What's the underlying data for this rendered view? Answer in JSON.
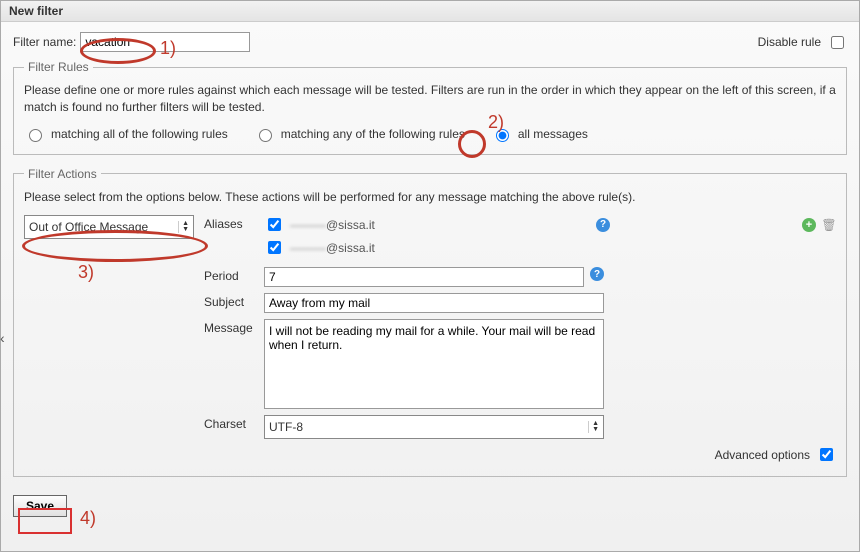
{
  "window": {
    "title": "New filter"
  },
  "filterName": {
    "label": "Filter name:",
    "value": "vacation"
  },
  "disable": {
    "label": "Disable rule"
  },
  "rules": {
    "legend": "Filter Rules",
    "help": "Please define one or more rules against which each message will be tested. Filters are run in the order in which they appear on the left of this screen, if a match is found no further filters will be tested.",
    "opts": {
      "all": "matching all of the following rules",
      "any": "matching any of the following rules",
      "allmsg": "all messages"
    }
  },
  "actions": {
    "legend": "Filter Actions",
    "help": "Please select from the options below. These actions will be performed for any message matching the above rule(s).",
    "actionType": "Out of Office Message",
    "labels": {
      "aliases": "Aliases",
      "period": "Period",
      "subject": "Subject",
      "message": "Message",
      "charset": "Charset",
      "advanced": "Advanced options"
    },
    "aliases": [
      {
        "addr": "@sissa.it",
        "prefix": "———"
      },
      {
        "addr": "@sissa.it",
        "prefix": "———"
      }
    ],
    "period": "7",
    "subject": "Away from my mail",
    "message": "I will not be reading my mail for a while. Your mail will be read when I return.",
    "charset": "UTF-8"
  },
  "save": {
    "label": "Save"
  },
  "annotations": {
    "n1": "1)",
    "n2": "2)",
    "n3": "3)",
    "n4": "4)"
  }
}
